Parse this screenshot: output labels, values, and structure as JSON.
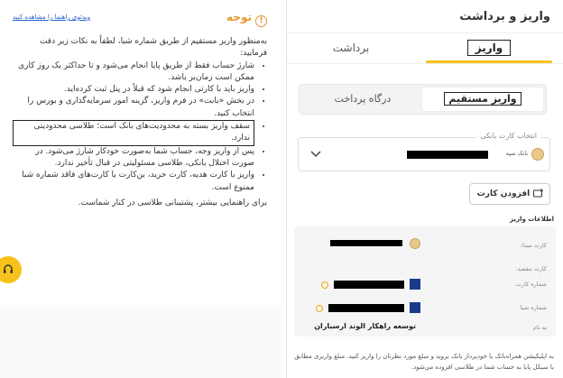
{
  "right": {
    "title": "واریز و برداشت",
    "tabs": {
      "deposit": "واریز",
      "withdraw": "برداشت"
    },
    "segment": {
      "gateway": "درگاه پرداخت",
      "direct": "واریز مستقیم"
    },
    "card_select": {
      "label": "انتخاب کارت بانکی",
      "bank_name": "بانک سپه"
    },
    "add_card": "افزودن کارت",
    "info_title": "اطلاعات واریز",
    "info": {
      "origin_label": "کارت مبدا:",
      "dest_label": "کارت مقصد:",
      "card_number_label": "شماره کارت",
      "sheba_label": "شماره شبا",
      "owner_label": "به نام",
      "company": "توسعه راهکار الوند ارسباران"
    },
    "footnote": "به اپلیکیشن همراه‌بانک یا خودپرداز بانک بروید و مبلغ مورد نظرتان را واریز کنید. مبلغ واریزی مطابق با سیکل پایا به حساب شما در طلاسی افزوده می‌شود."
  },
  "left": {
    "heading": "توجه",
    "video_link": "ویدئوی راهنما را مشاهده کنید",
    "intro": "به‌منظور واریز مستقیم از طریق شماره شبا، لطفاً به نکات زیر دقت فرمایید:",
    "items": [
      "شارژ حساب فقط از طریق پایا انجام می‌شود و تا حداکثر یک روز کاری ممکن است زمان‌بر باشد.",
      "واریز باید با کارتی انجام شود که قبلاً در پنل ثبت کرده‌اید.",
      "در بخش «بابت» در فرم واریز، گزینه امور سرمایه‌گذاری و بورس را انتخاب کنید.",
      "سقف واریز بسته به محدودیت‌های بانک است؛ طلاسی محدودیتی ندارد.",
      "پس از واریز وجه، حساب شما به‌صورت خودکار شارژ می‌شود. در صورت اختلال بانکی، طلاسی مسئولیتی در قبال تأخیر ندارد.",
      "واریز با کارت هدیه، کارت خرید، بن‌کارت یا کارت‌های فاقد شماره شبا ممنوع است."
    ],
    "outro": "برای راهنمایی بیشتر، پشتیبانی طلاسی در کنار شماست."
  },
  "colors": {
    "accent": "#f7c21b",
    "warning": "#e8952a",
    "link": "#2260c9"
  }
}
